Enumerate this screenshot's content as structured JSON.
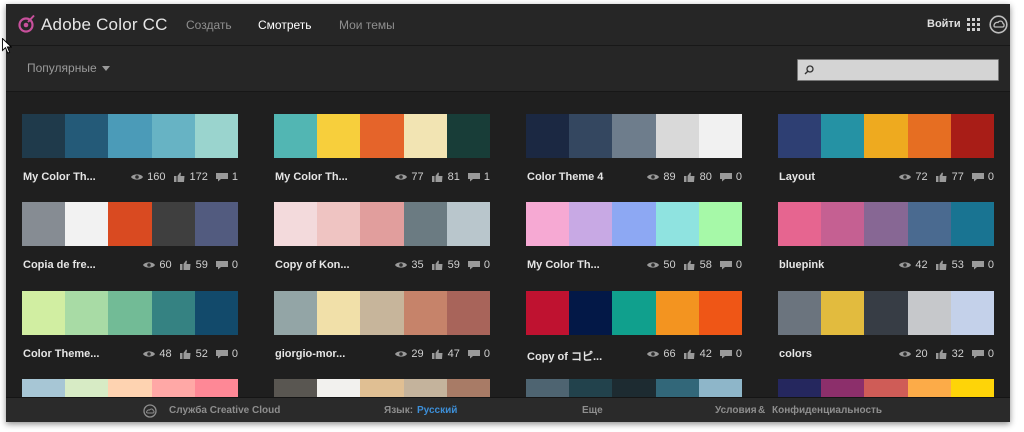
{
  "header": {
    "app_title": "Adobe Color CC",
    "nav": [
      "Создать",
      "Смотреть",
      "Мои темы"
    ],
    "active_nav": "Смотреть",
    "login": "Войти"
  },
  "toolbar": {
    "sort_label": "Популярные",
    "search_placeholder": ""
  },
  "themes": [
    {
      "name": "My Color Th...",
      "views": "160",
      "likes": "172",
      "comments": "1",
      "colors": [
        "#1f3a4b",
        "#245a78",
        "#4b9bb8",
        "#67b3c4",
        "#9ad4ce"
      ]
    },
    {
      "name": "My Color Th...",
      "views": "77",
      "likes": "81",
      "comments": "1",
      "colors": [
        "#52b6b3",
        "#f7cf3c",
        "#e5642a",
        "#f2e4b3",
        "#183d38"
      ]
    },
    {
      "name": "Color Theme 4",
      "views": "89",
      "likes": "80",
      "comments": "0",
      "colors": [
        "#1b2842",
        "#344760",
        "#6e7d8c",
        "#d9d9d9",
        "#f1f1f1"
      ]
    },
    {
      "name": "Layout",
      "views": "72",
      "likes": "77",
      "comments": "0",
      "colors": [
        "#2e3f73",
        "#2592a4",
        "#eeaa1f",
        "#e66e22",
        "#a81d17"
      ]
    },
    {
      "name": "Copia de fre...",
      "views": "60",
      "likes": "59",
      "comments": "0",
      "colors": [
        "#868c93",
        "#f2f2f2",
        "#d94a21",
        "#3f3f3f",
        "#525b7f"
      ]
    },
    {
      "name": "Copy of Kon...",
      "views": "35",
      "likes": "59",
      "comments": "0",
      "colors": [
        "#f3dadc",
        "#efc4c2",
        "#e19e9d",
        "#6b7b82",
        "#b9c6cc"
      ]
    },
    {
      "name": "My Color Th...",
      "views": "50",
      "likes": "58",
      "comments": "0",
      "colors": [
        "#f6a9d3",
        "#c8a9e4",
        "#8da8f3",
        "#8fe3e0",
        "#a6f9a8"
      ]
    },
    {
      "name": "bluepink",
      "views": "42",
      "likes": "53",
      "comments": "0",
      "colors": [
        "#e66590",
        "#c56092",
        "#876794",
        "#4a6a90",
        "#197492"
      ]
    },
    {
      "name": "Color Theme...",
      "views": "48",
      "likes": "52",
      "comments": "0",
      "colors": [
        "#d1eea2",
        "#a8dba5",
        "#72bb96",
        "#358282",
        "#124a6b"
      ]
    },
    {
      "name": "giorgio-mor...",
      "views": "29",
      "likes": "47",
      "comments": "0",
      "colors": [
        "#93a5a6",
        "#f1e0a9",
        "#c7b59b",
        "#c6836a",
        "#a8645a"
      ]
    },
    {
      "name": "Copy of コピ...",
      "views": "66",
      "likes": "42",
      "comments": "0",
      "colors": [
        "#bf1230",
        "#031847",
        "#10a08d",
        "#f39420",
        "#ef5616"
      ]
    },
    {
      "name": "colors",
      "views": "20",
      "likes": "32",
      "comments": "0",
      "colors": [
        "#6b747e",
        "#e2bb3e",
        "#373d45",
        "#c6c8cb",
        "#c4d1ea"
      ]
    },
    {
      "name": "",
      "views": "",
      "likes": "",
      "comments": "",
      "colors": [
        "#a7c6d5",
        "#d7ebc5",
        "#fed3b1",
        "#ffa8a6",
        "#fe8896"
      ]
    },
    {
      "name": "",
      "views": "",
      "likes": "",
      "comments": "",
      "colors": [
        "#595651",
        "#f2f1ee",
        "#e0bf93",
        "#c4b39c",
        "#a87b66"
      ]
    },
    {
      "name": "",
      "views": "",
      "likes": "",
      "comments": "",
      "colors": [
        "#4e6471",
        "#22424c",
        "#1d2b31",
        "#326779",
        "#8eb6c9"
      ]
    },
    {
      "name": "",
      "views": "",
      "likes": "",
      "comments": "",
      "colors": [
        "#25275e",
        "#8c2f6b",
        "#cf5c57",
        "#fcab48",
        "#fed408"
      ]
    }
  ],
  "footer": {
    "cc_service": "Служба Creative Cloud",
    "language_label": "Язык:",
    "language_value": "Русский",
    "more": "Еще",
    "terms": "Условия",
    "amp": "&",
    "privacy": "Конфиденциальность"
  },
  "colors": {
    "background": "#1f1f1f",
    "bar": "#262626",
    "link_accent": "#3d8fd8"
  }
}
